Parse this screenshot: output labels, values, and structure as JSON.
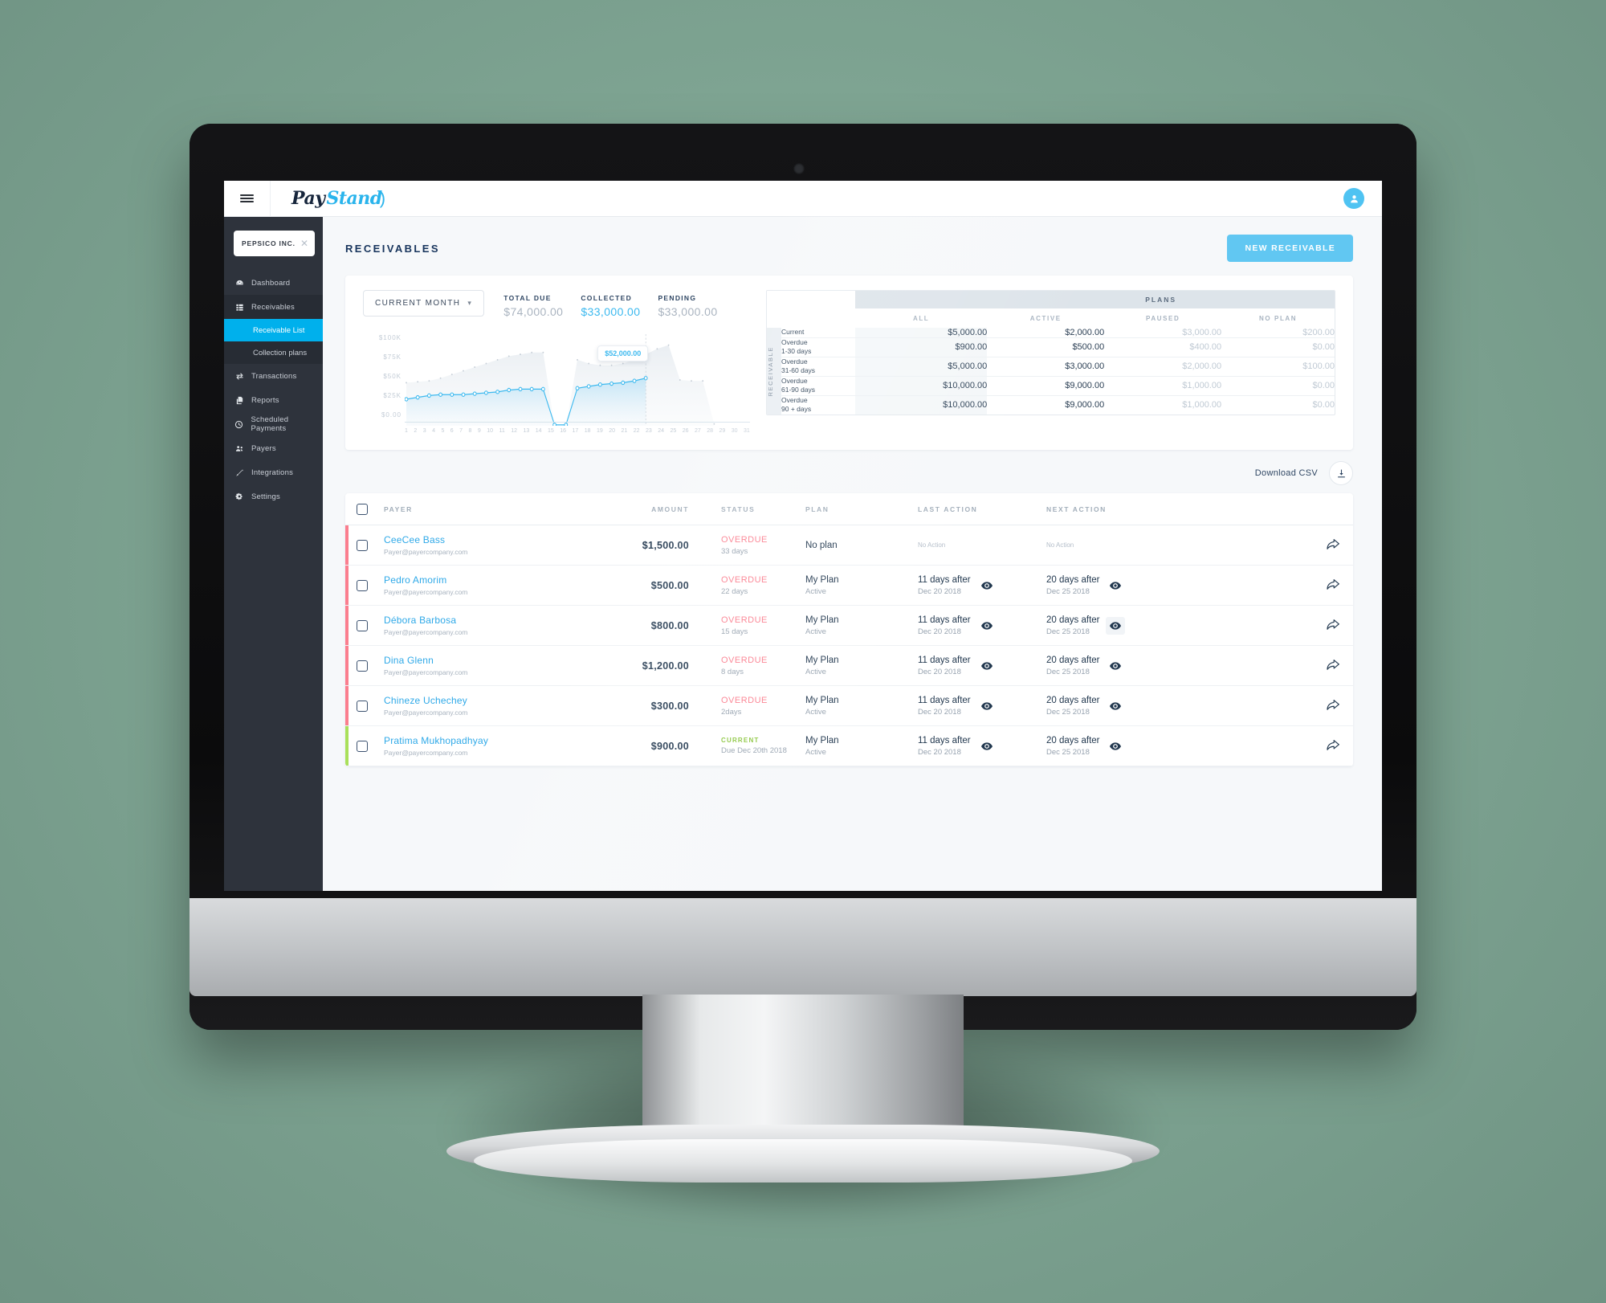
{
  "topbar": {
    "menu_icon": "hamburger-icon",
    "brand_part1": "Pay",
    "brand_part2": "Stand",
    "avatar_icon": "user-avatar-icon"
  },
  "sidebar": {
    "company": {
      "name": "PEPSICO INC.",
      "close_icon": "close-icon"
    },
    "items": [
      {
        "label": "Dashboard",
        "icon": "dashboard-icon"
      },
      {
        "label": "Receivables",
        "icon": "list-grid-icon"
      },
      {
        "label": "Transactions",
        "icon": "transfer-icon"
      },
      {
        "label": "Reports",
        "icon": "reports-icon"
      },
      {
        "label": "Scheduled Payments",
        "icon": "clock-icon"
      },
      {
        "label": "Payers",
        "icon": "people-icon"
      },
      {
        "label": "Integrations",
        "icon": "plug-icon"
      },
      {
        "label": "Settings",
        "icon": "gear-icon"
      }
    ],
    "subitems": [
      {
        "label": "Receivable List",
        "active": true
      },
      {
        "label": "Collection plans",
        "active": false
      }
    ]
  },
  "header": {
    "title": "RECEIVABLES",
    "new_button": "NEW RECEIVABLE"
  },
  "summary": {
    "period_label": "CURRENT MONTH",
    "period_chevron": "chevron-down-icon",
    "metrics": [
      {
        "label": "TOTAL DUE",
        "value": "$74,000.00",
        "accent": false
      },
      {
        "label": "COLLECTED",
        "value": "$33,000.00",
        "accent": true
      },
      {
        "label": "PENDING",
        "value": "$33,000.00",
        "accent": false
      }
    ]
  },
  "chart_data": {
    "type": "line",
    "title": "",
    "xlabel": "",
    "ylabel": "",
    "ylim": [
      0,
      100000
    ],
    "grid": false,
    "legend": "none",
    "y_ticks": [
      "$0.00",
      "$25K",
      "$50K",
      "$75K",
      "$100K"
    ],
    "x": [
      1,
      2,
      3,
      4,
      5,
      6,
      7,
      8,
      9,
      10,
      11,
      12,
      13,
      14,
      15,
      16,
      17,
      18,
      19,
      20,
      21,
      22,
      23,
      24,
      25,
      26,
      27,
      28,
      29,
      30,
      31
    ],
    "series": [
      {
        "name": "Collected",
        "color": "#3cb9ef",
        "values": [
          29000,
          31000,
          33000,
          34000,
          34000,
          34000,
          35000,
          36000,
          37000,
          39000,
          40000,
          40000,
          40000,
          1000,
          1000,
          41000,
          43000,
          45000,
          46000,
          47000,
          49000,
          52000,
          null,
          null,
          null,
          null,
          null,
          null,
          null,
          null,
          null
        ]
      },
      {
        "name": "Total",
        "color": "#dfe6ec",
        "values": [
          47000,
          48000,
          49000,
          52000,
          56000,
          60000,
          64000,
          68000,
          72000,
          76000,
          78000,
          80000,
          80000,
          0,
          0,
          72000,
          68000,
          66000,
          66000,
          68000,
          72000,
          78000,
          84000,
          88000,
          50000,
          49000,
          49000,
          2000,
          null,
          null,
          null
        ]
      }
    ],
    "annotation": {
      "label": "$52,000.00",
      "x": 22,
      "y": 52000
    }
  },
  "plans_table": {
    "group_header": "PLANS",
    "row_axis_label": "RECEIVABLE",
    "columns": [
      "ALL",
      "ACTIVE",
      "PAUSED",
      "NO PLAN"
    ],
    "rows": [
      {
        "label": "Current",
        "cells": [
          "$5,000.00",
          "$2,000.00",
          "$3,000.00",
          "$200.00"
        ]
      },
      {
        "label": "Overdue\n1-30 days",
        "cells": [
          "$900.00",
          "$500.00",
          "$400.00",
          "$0.00"
        ]
      },
      {
        "label": "Overdue\n31-60 days",
        "cells": [
          "$5,000.00",
          "$3,000.00",
          "$2,000.00",
          "$100.00"
        ]
      },
      {
        "label": "Overdue\n61-90 days",
        "cells": [
          "$10,000.00",
          "$9,000.00",
          "$1,000.00",
          "$0.00"
        ]
      },
      {
        "label": "Overdue\n90 + days",
        "cells": [
          "$10,000.00",
          "$9,000.00",
          "$1,000.00",
          "$0.00"
        ]
      }
    ]
  },
  "download": {
    "label": "Download CSV",
    "icon": "download-icon"
  },
  "list": {
    "headers": [
      "PAYER",
      "AMOUNT",
      "STATUS",
      "PLAN",
      "LAST ACTION",
      "NEXT ACTION"
    ],
    "rows": [
      {
        "payer": "CeeCee Bass",
        "email": "Payer@payercompany.com",
        "amount": "$1,500.00",
        "status": "OVERDUE",
        "status_type": "overdue",
        "status_detail": "33 days",
        "plan": "No plan",
        "plan_state": "",
        "last_action": "No Action",
        "last_action_date": "",
        "next_action": "No Action",
        "next_action_date": "",
        "has_eyes": false,
        "eye_highlight": false
      },
      {
        "payer": "Pedro Amorim",
        "email": "Payer@payercompany.com",
        "amount": "$500.00",
        "status": "OVERDUE",
        "status_type": "overdue",
        "status_detail": "22 days",
        "plan": "My Plan",
        "plan_state": "Active",
        "last_action": "11 days after",
        "last_action_date": "Dec 20 2018",
        "next_action": "20 days after",
        "next_action_date": "Dec 25 2018",
        "has_eyes": true,
        "eye_highlight": false
      },
      {
        "payer": "Débora Barbosa",
        "email": "Payer@payercompany.com",
        "amount": "$800.00",
        "status": "OVERDUE",
        "status_type": "overdue",
        "status_detail": "15 days",
        "plan": "My Plan",
        "plan_state": "Active",
        "last_action": "11 days after",
        "last_action_date": "Dec 20 2018",
        "next_action": "20 days after",
        "next_action_date": "Dec 25 2018",
        "has_eyes": true,
        "eye_highlight": true
      },
      {
        "payer": "Dina Glenn",
        "email": "Payer@payercompany.com",
        "amount": "$1,200.00",
        "status": "OVERDUE",
        "status_type": "overdue",
        "status_detail": "8 days",
        "plan": "My Plan",
        "plan_state": "Active",
        "last_action": "11 days after",
        "last_action_date": "Dec 20 2018",
        "next_action": "20 days after",
        "next_action_date": "Dec 25 2018",
        "has_eyes": true,
        "eye_highlight": false
      },
      {
        "payer": "Chineze Uchechey",
        "email": "Payer@payercompany.com",
        "amount": "$300.00",
        "status": "OVERDUE",
        "status_type": "overdue",
        "status_detail": "2days",
        "plan": "My Plan",
        "plan_state": "Active",
        "last_action": "11 days after",
        "last_action_date": "Dec 20 2018",
        "next_action": "20 days after",
        "next_action_date": "Dec 25 2018",
        "has_eyes": true,
        "eye_highlight": false
      },
      {
        "payer": "Pratima Mukhopadhyay",
        "email": "Payer@payercompany.com",
        "amount": "$900.00",
        "status": "CURRENT",
        "status_type": "current",
        "status_detail": "Due Dec 20th 2018",
        "plan": "My Plan",
        "plan_state": "Active",
        "last_action": "11 days after",
        "last_action_date": "Dec 20 2018",
        "next_action": "20 days after",
        "next_action_date": "Dec 25 2018",
        "has_eyes": true,
        "eye_highlight": false
      }
    ],
    "send_icon": "send-arrow-icon",
    "eye_icon": "eye-icon"
  },
  "colors": {
    "accent": "#00b0ec",
    "button": "#61c7f2",
    "overdue": "#fb7e8e",
    "current": "#8cc63f",
    "sidebar": "#2e333c",
    "navy": "#17345c"
  }
}
